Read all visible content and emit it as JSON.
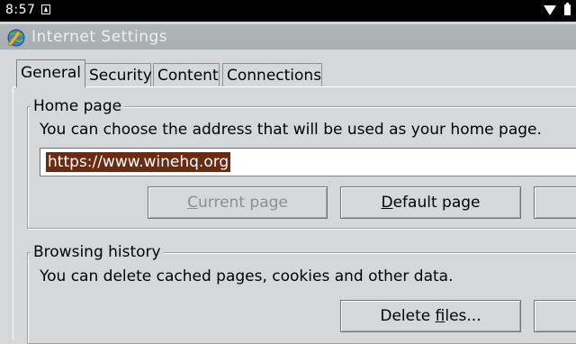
{
  "status_bar": {
    "time": "8:57"
  },
  "window": {
    "title": "Internet Settings"
  },
  "tabs": [
    {
      "label": "General",
      "active": true
    },
    {
      "label": "Security",
      "active": false
    },
    {
      "label": "Content",
      "active": false
    },
    {
      "label": "Connections",
      "active": false
    }
  ],
  "home_page": {
    "group_title": "Home page",
    "description": "You can choose the address that will be used as your home page.",
    "url_value": "https://www.winehq.org",
    "current_page_button": {
      "pre": "",
      "mnemonic": "C",
      "post": "urrent page",
      "disabled": true
    },
    "default_page_button": {
      "pre": "",
      "mnemonic": "D",
      "post": "efault page",
      "disabled": false
    }
  },
  "browsing_history": {
    "group_title": "Browsing history",
    "description": "You can delete cached pages, cookies and other data.",
    "delete_button": {
      "pre": "Delete ",
      "mnemonic": "f",
      "post": "iles..."
    }
  }
}
